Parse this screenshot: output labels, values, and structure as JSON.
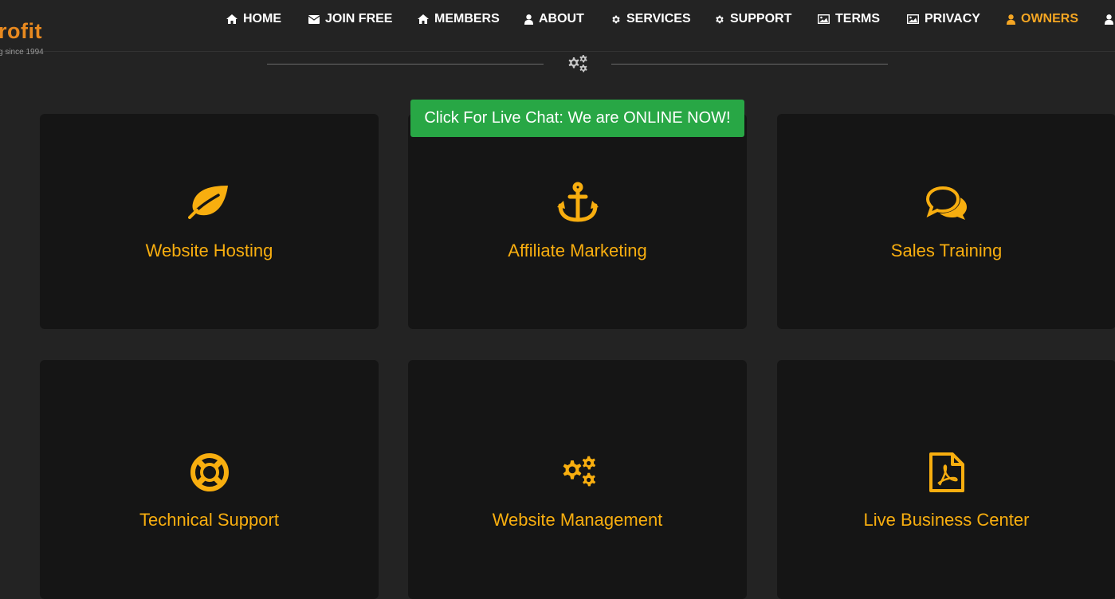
{
  "logo": {
    "text": "rofit",
    "tagline": "g since 1994"
  },
  "nav": {
    "items": [
      {
        "label": "HOME",
        "icon": "home-icon"
      },
      {
        "label": "JOIN FREE",
        "icon": "envelope-icon"
      },
      {
        "label": "MEMBERS",
        "icon": "home-icon"
      },
      {
        "label": "ABOUT",
        "icon": "user-icon"
      },
      {
        "label": "SERVICES",
        "icon": "gear-icon"
      },
      {
        "label": "SUPPORT",
        "icon": "gear-icon"
      },
      {
        "label": "TERMS",
        "icon": "image-icon"
      },
      {
        "label": "PRIVACY",
        "icon": "image-icon"
      },
      {
        "label": "OWNERS",
        "icon": "user-icon",
        "active": true
      }
    ]
  },
  "live_chat": {
    "label": "Click For Live Chat: We are ONLINE NOW!"
  },
  "services": [
    {
      "title": "Website Hosting",
      "icon": "leaf-icon"
    },
    {
      "title": "Affiliate Marketing",
      "icon": "anchor-icon"
    },
    {
      "title": "Sales Training",
      "icon": "comments-icon"
    },
    {
      "title": "Technical Support",
      "icon": "life-ring-icon"
    },
    {
      "title": "Website Management",
      "icon": "gears-icon"
    },
    {
      "title": "Live Business Center",
      "icon": "file-pdf-icon"
    }
  ],
  "colors": {
    "accent": "#f8ae0f",
    "nav_active": "#f5a623",
    "logo": "#e8891f",
    "chat_button": "#28a745",
    "card_bg": "#151515",
    "page_bg": "#232323"
  }
}
